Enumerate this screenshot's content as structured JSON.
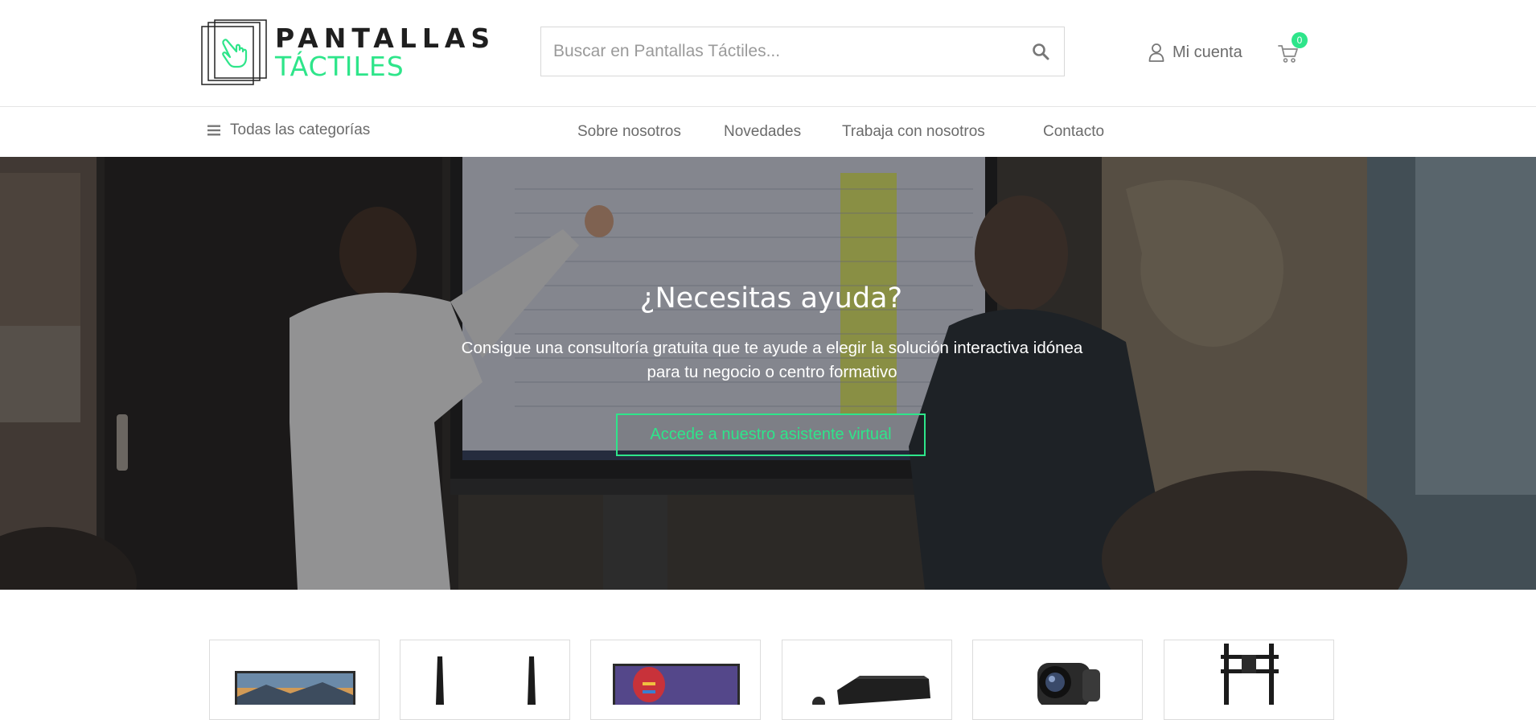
{
  "brand": {
    "line1": "PANTALLAS",
    "line2": "TÁCTILES",
    "accent_color": "#2ee58a"
  },
  "search": {
    "placeholder": "Buscar en Pantallas Táctiles...",
    "value": "",
    "icon": "search-icon"
  },
  "header": {
    "account_label": "Mi cuenta",
    "account_icon": "user-icon",
    "cart_icon": "cart-icon",
    "cart_count": "0"
  },
  "nav": {
    "categories_label": "Todas las categorías",
    "categories_icon": "menu-icon",
    "links": [
      {
        "label": "Sobre nosotros"
      },
      {
        "label": "Novedades"
      },
      {
        "label": "Trabaja con nosotros"
      },
      {
        "label": "Contacto"
      }
    ]
  },
  "hero": {
    "title": "¿Necesitas ayuda?",
    "text": "Consigue una consultoría gratuita que te ayude a elegir la solución interactiva idónea para tu negocio o centro formativo",
    "button_label": "Accede a nuestro asistente virtual"
  },
  "products": [
    {
      "name": "interactive-display"
    },
    {
      "name": "wireless-antenna"
    },
    {
      "name": "interactive-display"
    },
    {
      "name": "media-box"
    },
    {
      "name": "conference-camera"
    },
    {
      "name": "floor-stand"
    }
  ]
}
